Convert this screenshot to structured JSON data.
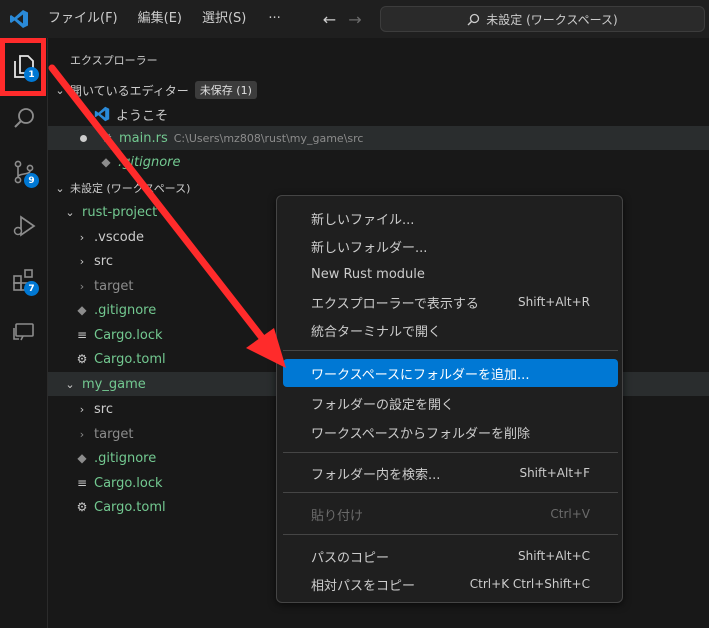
{
  "titlebar": {
    "menu": [
      "ファイル(F)",
      "編集(E)",
      "選択(S)",
      "···"
    ],
    "search_text": "未設定 (ワークスペース)"
  },
  "activity": {
    "explorer_badge": "1",
    "scm_badge": "9",
    "extensions_badge": "7"
  },
  "explorer": {
    "title": "エクスプローラー",
    "open_editors": {
      "label": "開いているエディター",
      "badge": "未保存 (1)",
      "items": [
        {
          "name": "ようこそ"
        },
        {
          "name": "main.rs",
          "path": "C:\\Users\\mz808\\rust\\my_game\\src"
        },
        {
          "name": ".gitignore"
        }
      ]
    },
    "workspace": {
      "label": "未設定 (ワークスペース)",
      "folders": [
        {
          "name": "rust-project",
          "children": [
            ".vscode",
            "src",
            "target",
            ".gitignore",
            "Cargo.lock",
            "Cargo.toml"
          ]
        },
        {
          "name": "my_game",
          "children": [
            "src",
            "target",
            ".gitignore",
            "Cargo.lock",
            "Cargo.toml"
          ]
        }
      ]
    }
  },
  "context_menu": {
    "items": [
      {
        "label": "新しいファイル...",
        "shortcut": ""
      },
      {
        "label": "新しいフォルダー...",
        "shortcut": ""
      },
      {
        "label": "New Rust module",
        "shortcut": ""
      },
      {
        "label": "エクスプローラーで表示する",
        "shortcut": "Shift+Alt+R"
      },
      {
        "label": "統合ターミナルで開く",
        "shortcut": ""
      },
      {
        "label": "ワークスペースにフォルダーを追加...",
        "shortcut": ""
      },
      {
        "label": "フォルダーの設定を開く",
        "shortcut": ""
      },
      {
        "label": "ワークスペースからフォルダーを削除",
        "shortcut": ""
      },
      {
        "label": "フォルダー内を検索...",
        "shortcut": "Shift+Alt+F"
      },
      {
        "label": "貼り付け",
        "shortcut": "Ctrl+V"
      },
      {
        "label": "パスのコピー",
        "shortcut": "Shift+Alt+C"
      },
      {
        "label": "相対パスをコピー",
        "shortcut": "Ctrl+K Ctrl+Shift+C"
      }
    ],
    "active_index": 5,
    "disabled_index": 9
  },
  "colors": {
    "accent": "#0078d4",
    "annotation": "#ff2b2b",
    "git_untracked": "#73c991"
  }
}
